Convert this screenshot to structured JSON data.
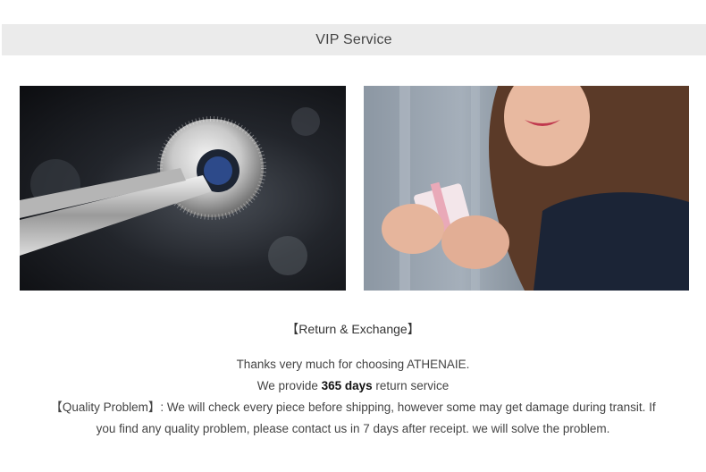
{
  "header": {
    "title": "VIP Service"
  },
  "return_section": {
    "title": "【Return & Exchange】",
    "thanks_line": "Thanks very much for choosing ATHENAIE.",
    "provide_prefix": "We provide",
    "provide_days": "365 days",
    "provide_suffix": "return service",
    "quality_line_1": "【Quality Problem】: We will check every piece before shipping, however some may get damage during transit. If",
    "quality_line_2": "you find any quality problem, please contact us in 7 days after receipt. we will solve the problem."
  },
  "images": {
    "left_photo": "charm-in-tweezers-photo",
    "right_photo": "woman-opening-gift-photo"
  },
  "colors": {
    "header_bg": "#ebebeb",
    "text": "#444444"
  }
}
